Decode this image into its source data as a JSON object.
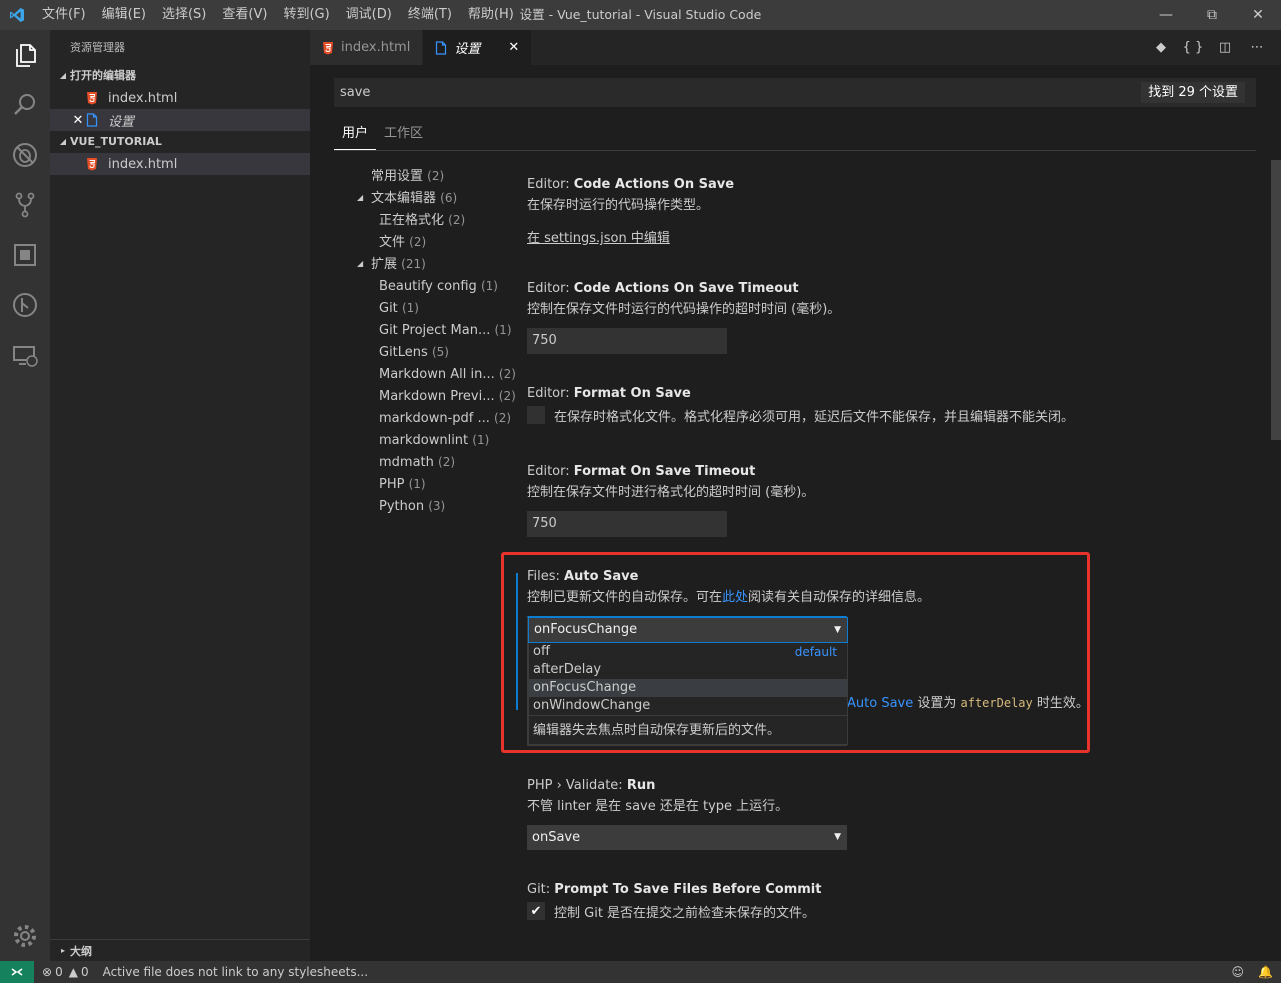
{
  "window": {
    "title": "设置 - Vue_tutorial - Visual Studio Code",
    "menu": [
      "文件(F)",
      "编辑(E)",
      "选择(S)",
      "查看(V)",
      "转到(G)",
      "调试(D)",
      "终端(T)",
      "帮助(H)"
    ]
  },
  "sidebar": {
    "title": "资源管理器",
    "open_editors_label": "打开的编辑器",
    "open_editors": [
      {
        "name": "index.html"
      },
      {
        "name": "设置"
      }
    ],
    "folder_label": "VUE_TUTORIAL",
    "files": [
      {
        "name": "index.html"
      }
    ],
    "outline_label": "大纲"
  },
  "tabs": [
    {
      "label": "index.html"
    },
    {
      "label": "设置"
    }
  ],
  "search": {
    "value": "save",
    "count_label": "找到 29 个设置"
  },
  "scopes": [
    "用户",
    "工作区"
  ],
  "toc": [
    {
      "label": "常用设置",
      "count": "(2)"
    },
    {
      "label": "文本编辑器",
      "count": "(6)"
    },
    {
      "label": "正在格式化",
      "count": "(2)"
    },
    {
      "label": "文件",
      "count": "(2)"
    },
    {
      "label": "扩展",
      "count": "(21)"
    },
    {
      "label": "Beautify config",
      "count": "(1)"
    },
    {
      "label": "Git",
      "count": "(1)"
    },
    {
      "label": "Git Project Man...",
      "count": "(1)"
    },
    {
      "label": "GitLens",
      "count": "(5)"
    },
    {
      "label": "Markdown All in...",
      "count": "(2)"
    },
    {
      "label": "Markdown Previ...",
      "count": "(2)"
    },
    {
      "label": "markdown-pdf ...",
      "count": "(2)"
    },
    {
      "label": "markdownlint",
      "count": "(1)"
    },
    {
      "label": "mdmath",
      "count": "(2)"
    },
    {
      "label": "PHP",
      "count": "(1)"
    },
    {
      "label": "Python",
      "count": "(3)"
    }
  ],
  "settings": {
    "code_actions": {
      "category": "Editor: ",
      "name": "Code Actions On Save",
      "desc": "在保存时运行的代码操作类型。",
      "link": "在 settings.json 中编辑"
    },
    "code_actions_timeout": {
      "category": "Editor: ",
      "name": "Code Actions On Save Timeout",
      "desc": "控制在保存文件时运行的代码操作的超时时间 (毫秒)。",
      "value": "750"
    },
    "format_on_save": {
      "category": "Editor: ",
      "name": "Format On Save",
      "desc": "在保存时格式化文件。格式化程序必须可用，延迟后文件不能保存，并且编辑器不能关闭。"
    },
    "format_on_save_timeout": {
      "category": "Editor: ",
      "name": "Format On Save Timeout",
      "desc": "控制在保存文件时进行格式化的超时时间 (毫秒)。",
      "value": "750"
    },
    "auto_save": {
      "category": "Files: ",
      "name": "Auto Save",
      "desc_before": "控制已更新文件的自动保存。可在",
      "desc_link": "此处",
      "desc_after": "阅读有关自动保存的详细信息。",
      "value": "onFocusChange",
      "options": [
        "off",
        "afterDelay",
        "onFocusChange",
        "onWindowChange"
      ],
      "default_tag": "default",
      "option_desc": "编辑器失去焦点时自动保存更新后的文件。"
    },
    "auto_save_delay": {
      "link": "Auto Save",
      "text_mid": " 设置为 ",
      "code": "afterDelay",
      "text_end": " 时生效。"
    },
    "php_validate": {
      "category": "PHP › Validate: ",
      "name": "Run",
      "desc": "不管 linter 是在 save 还是在 type 上运行。",
      "value": "onSave"
    },
    "git_prompt": {
      "category": "Git: ",
      "name": "Prompt To Save Files Before Commit",
      "desc": "控制 Git 是否在提交之前检查未保存的文件。"
    }
  },
  "statusbar": {
    "errors": "0",
    "warnings": "0",
    "message": "Active file does not link to any stylesheets..."
  },
  "colors": {
    "accent": "#0c7dd1",
    "link": "#3794ff",
    "highlight_box": "#e8332d",
    "remote": "#16825d"
  }
}
